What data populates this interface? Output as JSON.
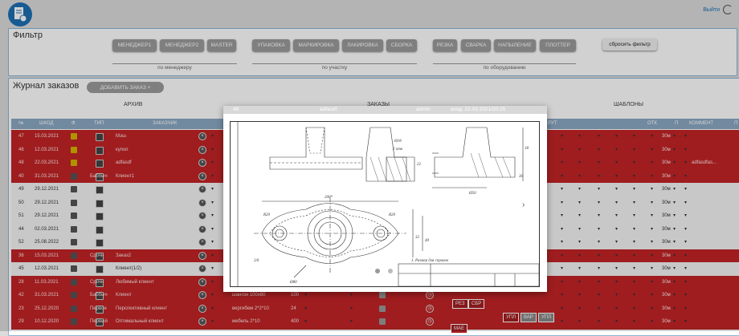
{
  "header": {
    "exit_label": "Выйти"
  },
  "filter": {
    "title": "Фильтр",
    "manager_buttons": [
      "МЕНЕДЖЕР1",
      "МЕНЕДЖЕР2",
      "MASTER"
    ],
    "manager_group": "по менеджеру",
    "section_buttons": [
      "УПАКОВКА",
      "МАРКИРОВКА",
      "ЛАКИРОВКА",
      "СБОРКА"
    ],
    "section_group": "по участку",
    "equipment_buttons": [
      "РЕЗКА",
      "СВАРКА",
      "НАПЫЛЕНИЕ",
      "ПЛОТТЕР"
    ],
    "equipment_group": "по оборудованию",
    "reset_label": "сбросить фильтр"
  },
  "journal": {
    "title": "Журнал заказов",
    "add_label": "ДОБАВИТЬ ЗАКАЗ +",
    "sections": [
      "АРХИВ",
      "ЗАКАЗЫ",
      "ШАБЛОНЫ"
    ],
    "columns": [
      "№",
      "ШКОД",
      "Ф",
      "ТИП",
      "ЗАКАЗЧИК",
      "РУТ",
      "ОТК",
      "П",
      "КОММЕНТ",
      "П"
    ],
    "rows": [
      {
        "num": "47",
        "date": "15.03.2021",
        "type": "",
        "customer": "Мэш",
        "style": "red",
        "comment": "",
        "otk": "30м"
      },
      {
        "num": "46",
        "date": "12.03.2021",
        "type": "",
        "customer": "купоп",
        "style": "red",
        "comment": "",
        "otk": "30м"
      },
      {
        "num": "48",
        "date": "22.03.2021",
        "type": "",
        "customer": "adfasdf",
        "style": "red",
        "comment": "adfasdfas...",
        "otk": "30м"
      },
      {
        "num": "40",
        "date": "31.03.2021",
        "type": "Баббыч",
        "customer": "Клиент1",
        "style": "red",
        "comment": "",
        "otk": "30м"
      },
      {
        "num": "49",
        "date": "29.12.2021",
        "type": "",
        "customer": "",
        "style": "white",
        "comment": "",
        "otk": "30м"
      },
      {
        "num": "50",
        "date": "29.12.2021",
        "type": "",
        "customer": "",
        "style": "white",
        "comment": "",
        "otk": "30м"
      },
      {
        "num": "51",
        "date": "29.12.2021",
        "type": "",
        "customer": "",
        "style": "white",
        "comment": "",
        "otk": "30м"
      },
      {
        "num": "44",
        "date": "02.03.2021",
        "type": "",
        "customer": "",
        "style": "white",
        "comment": "",
        "otk": "30м"
      },
      {
        "num": "52",
        "date": "25.08.2022",
        "type": "",
        "customer": "",
        "style": "white",
        "comment": "",
        "otk": "30м"
      },
      {
        "num": "36",
        "date": "15.03.2021",
        "type": "Срочн",
        "customer": "Заказ2",
        "style": "red",
        "comment": "",
        "otk": "30м"
      },
      {
        "num": "45",
        "date": "12.03.2021",
        "type": "",
        "customer": "Клиент(1/2)",
        "style": "white",
        "comment": "",
        "otk": "30м"
      },
      {
        "num": "28",
        "date": "11.03.2021",
        "type": "Срочн",
        "customer": "Любимый клиент",
        "style": "red",
        "comment": "",
        "otk": "30м"
      },
      {
        "num": "42",
        "date": "31.03.2021",
        "type": "Баббыч",
        "customer": "Клиент",
        "style": "red",
        "comment": "",
        "otk": "30м",
        "material": "шангон 100х60",
        "qty": "100"
      },
      {
        "num": "23",
        "date": "25.12.2020",
        "type": "Первое",
        "customer": "Перспективный клиент",
        "style": "red",
        "comment": "",
        "otk": "30м",
        "material": "вергибем 2*2*10",
        "qty": "24"
      },
      {
        "num": "29",
        "date": "10.12.2020",
        "type": "Первый",
        "customer": "Оптимальный клиент",
        "style": "red",
        "comment": "",
        "otk": "30м",
        "material": "мебель 2*10",
        "qty": "400"
      }
    ]
  },
  "tags": {
    "rez": "РЕЗ",
    "sbr": "СБР",
    "upl": "УПЛ",
    "var": "ВАР",
    "upl2": "УПЛ",
    "mae": "МАЕ"
  },
  "modal": {
    "id": "48",
    "title": "adfasdf",
    "user": "admin",
    "login": "вход: 22.03.2021/20:25",
    "drawing_note": "1. Размер для справок",
    "dims": {
      "d200": "200*",
      "r20a": "R20",
      "r20b": "R20",
      "d32": "32",
      "d40": "40",
      "d216": "2/6",
      "d80": "Ø80",
      "d18": "Ø18",
      "d2": "2 отв",
      "d50": "Ø50",
      "d22": "22",
      "d30": "30",
      "d18b": "18"
    }
  }
}
